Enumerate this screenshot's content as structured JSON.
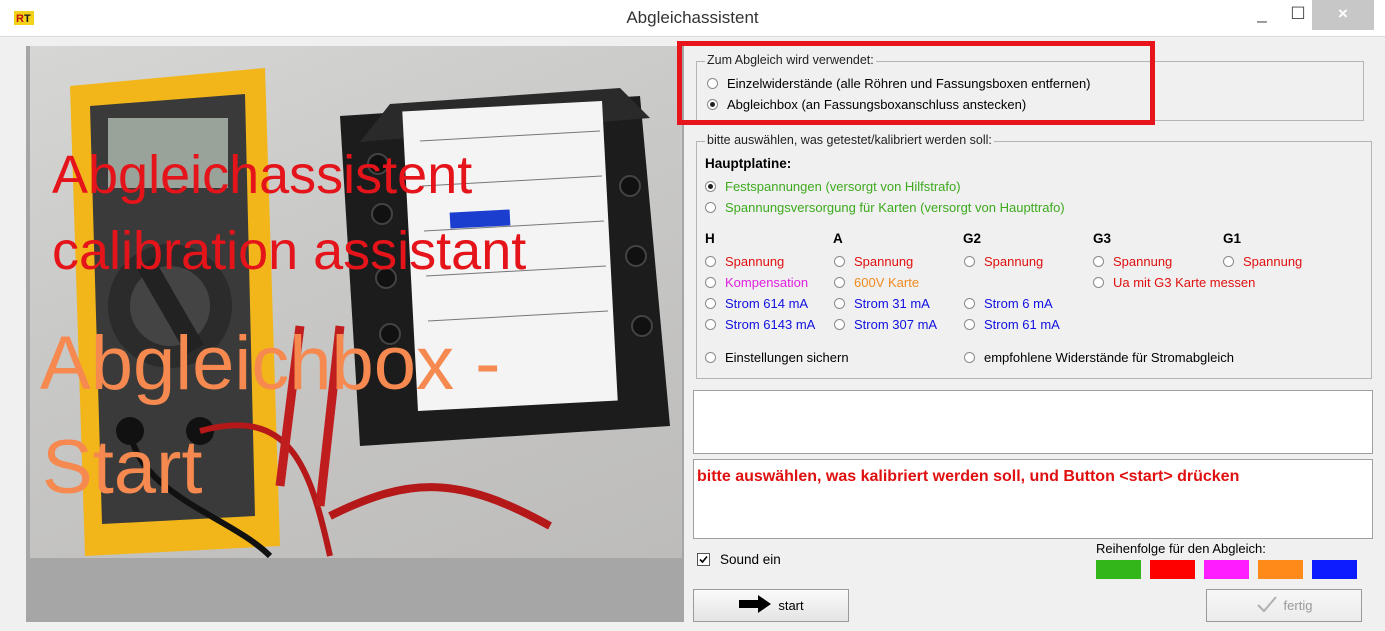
{
  "window": {
    "title": "Abgleichassistent",
    "app_icon": "rc-logo-icon",
    "min_symbol": "_",
    "max_symbol": "☐",
    "close_symbol": "×"
  },
  "image_overlay": {
    "line1": "Abgleichassistent",
    "line2": "calibration assistant",
    "line3": "Abgleichbox -",
    "line4": "Start",
    "color_red": "#e4141a",
    "color_orange": "#f5894f"
  },
  "group_mode": {
    "title": "Zum Abgleich wird verwendet:",
    "options": [
      {
        "label": "Einzelwiderstände (alle Röhren und  Fassungsboxen entfernen)",
        "checked": false
      },
      {
        "label": "Abgleichbox (an Fassungsboxanschluss anstecken)",
        "checked": true
      }
    ]
  },
  "group_select": {
    "title": "bitte auswählen, was  getestet/kalibriert werden soll:",
    "mainboard_heading": "Hauptplatine:",
    "mainboard_options": [
      {
        "label": "Festspannungen (versorgt von Hilfstrafo)",
        "checked": true,
        "color": "#3daa1e"
      },
      {
        "label": "Spannungsversorgung für Karten (versorgt von Haupttrafo)",
        "checked": false,
        "color": "#3daa1e"
      }
    ],
    "columns": [
      "H",
      "A",
      "G2",
      "G3",
      "G1"
    ],
    "h": [
      {
        "label": "Spannung",
        "color": "#e01010"
      },
      {
        "label": "Kompensation",
        "color": "#e020e0"
      },
      {
        "label": "Strom 614 mA",
        "color": "#1010e0"
      },
      {
        "label": "Strom 6143 mA",
        "color": "#1010e0"
      }
    ],
    "a": [
      {
        "label": "Spannung",
        "color": "#e01010"
      },
      {
        "label": "600V Karte",
        "color": "#f08a1e"
      },
      {
        "label": "Strom 31 mA",
        "color": "#1010e0"
      },
      {
        "label": "Strom 307 mA",
        "color": "#1010e0"
      }
    ],
    "g2": [
      {
        "label": "Spannung",
        "color": "#e01010"
      },
      {
        "label": "Strom 6 mA",
        "color": "#1010e0"
      },
      {
        "label": "Strom 61 mA",
        "color": "#1010e0"
      }
    ],
    "g3": [
      {
        "label": "Spannung",
        "color": "#e01010"
      },
      {
        "label": "Ua mit G3 Karte messen",
        "color": "#e01010"
      }
    ],
    "g1": [
      {
        "label": "Spannung",
        "color": "#e01010"
      }
    ],
    "save_settings": "Einstellungen sichern",
    "recommended_resistors": "empfohlene Widerstände für Stromabgleich"
  },
  "info_box": {
    "text": ""
  },
  "instruction_box": {
    "text": "bitte auswählen, was kalibriert werden soll, und Button <start> drücken",
    "color": "#e01010"
  },
  "sound": {
    "label": "Sound ein",
    "checked": true
  },
  "order": {
    "label": "Reihenfolge für den Abgleich:",
    "colors": [
      "#33b61a",
      "#ff0000",
      "#ff1dff",
      "#ff8a1a",
      "#0d1bff"
    ]
  },
  "buttons": {
    "start": "start",
    "finish": "fertig"
  }
}
